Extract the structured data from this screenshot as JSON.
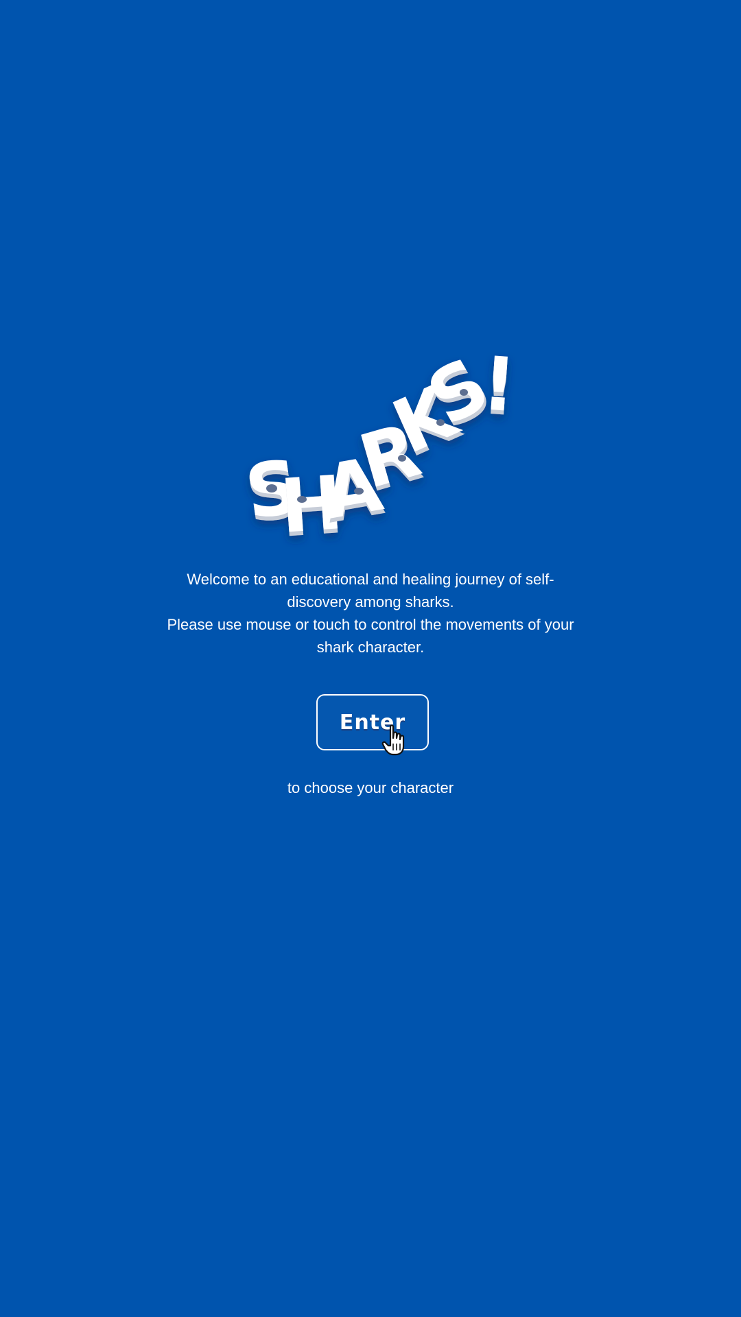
{
  "app": {
    "background_color": "#0054AE",
    "logo_text": "SHARKS!"
  },
  "intro": {
    "line1": "Welcome to an educational and healing journey of self-discovery among sharks.",
    "line2": "Please use mouse or touch to control the movements of your shark character."
  },
  "enter_button": {
    "label": "Enter"
  },
  "subtitle": "to choose your character",
  "icons": {
    "cursor": "hand-pointer-icon"
  }
}
